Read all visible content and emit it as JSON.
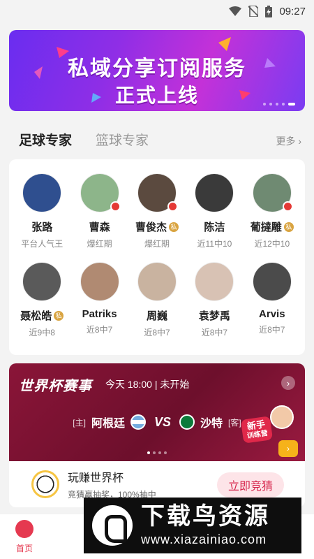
{
  "status": {
    "time": "09:27"
  },
  "banner": {
    "line1": "私域分享订阅服务",
    "line2": "正式上线",
    "slides": 5,
    "active_slide": 5
  },
  "tabs": [
    {
      "label": "足球专家",
      "active": true
    },
    {
      "label": "篮球专家",
      "active": false
    }
  ],
  "more_label": "更多",
  "experts": [
    {
      "name": "张路",
      "sub": "平台人气王",
      "private": false,
      "hot": false,
      "avatar_color": "#2f4f8f"
    },
    {
      "name": "曹森",
      "sub": "爆红期",
      "private": false,
      "hot": true,
      "avatar_color": "#8db58a"
    },
    {
      "name": "曹俊杰",
      "sub": "爆红期",
      "private": true,
      "hot": true,
      "avatar_color": "#5b4a3f"
    },
    {
      "name": "陈洁",
      "sub": "近11中10",
      "private": false,
      "hot": false,
      "avatar_color": "#3a3a3a"
    },
    {
      "name": "葡撻雕",
      "sub": "近12中10",
      "private": true,
      "hot": true,
      "avatar_color": "#6f8a72"
    },
    {
      "name": "聂松皓",
      "sub": "近9中8",
      "private": true,
      "hot": false,
      "avatar_color": "#5a5a5a"
    },
    {
      "name": "Patriks",
      "sub": "近8中7",
      "private": false,
      "hot": false,
      "avatar_color": "#b08a72"
    },
    {
      "name": "周巍",
      "sub": "近8中7",
      "private": false,
      "hot": false,
      "avatar_color": "#c9b3a0"
    },
    {
      "name": "袁梦禹",
      "sub": "近8中7",
      "private": false,
      "hot": false,
      "avatar_color": "#d8c2b4"
    },
    {
      "name": "Arvis",
      "sub": "近8中7",
      "private": false,
      "hot": false,
      "avatar_color": "#4b4b4b"
    }
  ],
  "private_badge": "私",
  "worldcup": {
    "title": "世界杯赛事",
    "time": "今天 18:00  |  未开始",
    "home_tag": "[主]",
    "home_team": "阿根廷",
    "vs": "VS",
    "away_team": "沙特",
    "away_tag": "[客]",
    "camp_line1": "新手",
    "camp_line2": "训练营",
    "slides": 4,
    "active_slide": 1
  },
  "promo": {
    "title": "玩赚世界杯",
    "subtitle": "竞猜赢抽奖，100%抽中",
    "button": "立即竞猜"
  },
  "bottom_nav": {
    "home_label": "首页"
  },
  "watermark": {
    "brand": "下载鸟资源",
    "url": "www.xiazainiao.com"
  }
}
